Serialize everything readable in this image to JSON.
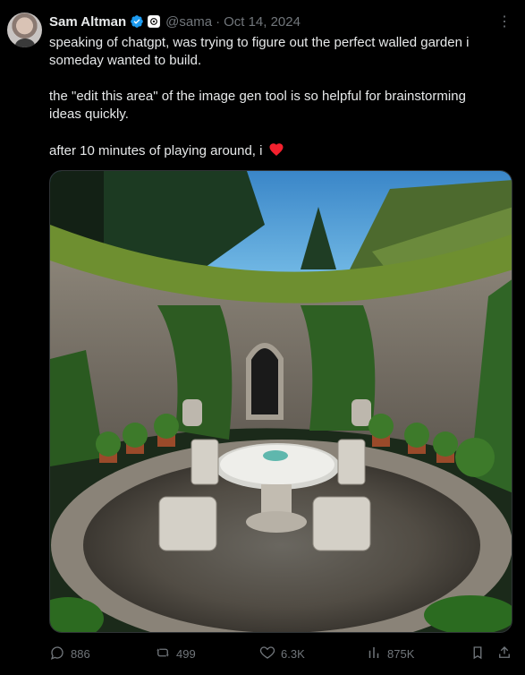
{
  "author": {
    "name": "Sam Altman",
    "handle": "@sama",
    "date": "Oct 14, 2024",
    "verified_icon": "verified-badge-icon",
    "affiliation_icon": "openai-logo-icon"
  },
  "tweet": {
    "line1": "speaking of chatgpt, was trying to figure out the perfect walled garden i",
    "line2": "someday wanted to build.",
    "line3": "the \"edit this area\" of the image gen tool is so helpful for brainstorming",
    "line4": "ideas quickly.",
    "line5": "after 10 minutes of playing around, i"
  },
  "media": {
    "icon": "walled-garden-image"
  },
  "actions": {
    "replies": "886",
    "retweets": "499",
    "likes": "6.3K",
    "views": "875K"
  },
  "colors": {
    "background": "#000000",
    "text": "#e7e9ea",
    "muted": "#71767b",
    "verified": "#1d9bf0",
    "heart": "#f91880"
  }
}
